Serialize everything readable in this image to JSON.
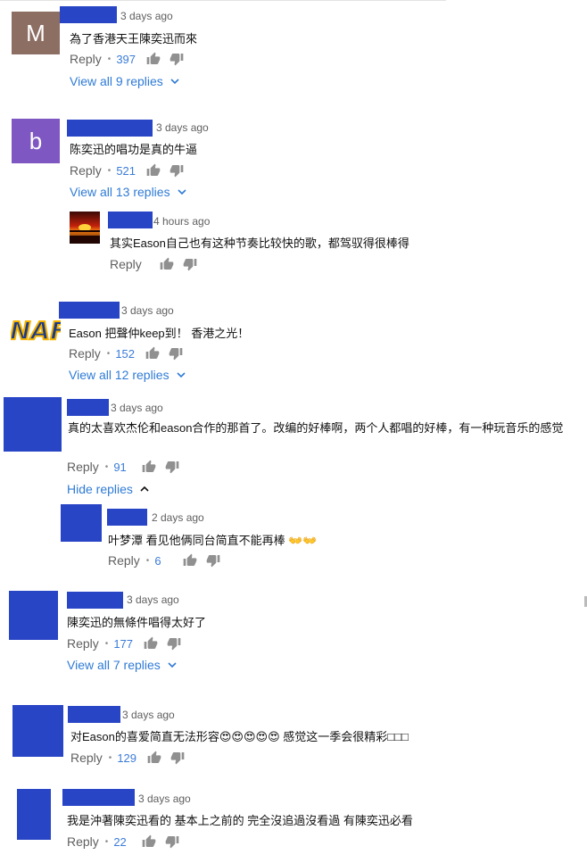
{
  "comments": [
    {
      "avatar_letter": "M",
      "avatar_color": "#8d6e63",
      "time": "3 days ago",
      "text": "為了香港天王陳奕迅而來",
      "reply_label": "Reply",
      "likes": "397",
      "view_replies": "View all 9 replies"
    },
    {
      "avatar_letter": "b",
      "avatar_color": "#7e57c2",
      "time": "3 days ago",
      "text": "陈奕迅的唱功是真的牛逼",
      "reply_label": "Reply",
      "likes": "521",
      "view_replies": "View all 13 replies",
      "reply": {
        "time": "4 hours ago",
        "text": "其实Eason自己也有这种节奏比较快的歌，都驾驭得很棒得",
        "reply_label": "Reply"
      }
    },
    {
      "avatar_text": "NAF",
      "time": "3 days ago",
      "text": "Eason 把聲仲keep到！ 香港之光！",
      "reply_label": "Reply",
      "likes": "152",
      "view_replies": "View all 12 replies"
    },
    {
      "time": "3 days ago",
      "text": "真的太喜欢杰伦和eason合作的那首了。改编的好棒啊，两个人都唱的好棒，有一种玩音乐的感觉",
      "reply_label": "Reply",
      "likes": "91",
      "hide_replies": "Hide replies",
      "reply": {
        "time": "2 days ago",
        "text": "叶梦潭 看见他俩同台简直不能再棒 👐👐",
        "reply_label": "Reply",
        "likes": "6"
      }
    },
    {
      "time": "3 days ago",
      "text": "陳奕迅的無條件唱得太好了",
      "reply_label": "Reply",
      "likes": "177",
      "view_replies": "View all 7 replies"
    },
    {
      "time": "3 days ago",
      "text": "对Eason的喜爱简直无法形容😍😍😍😍😍 感觉这一季会很精彩□□□",
      "reply_label": "Reply",
      "likes": "129"
    },
    {
      "time": "3 days ago",
      "text": "我是沖著陳奕迅看的 基本上之前的 完全沒追過沒看過 有陳奕迅必看",
      "reply_label": "Reply",
      "likes": "22"
    }
  ],
  "colors": {
    "redaction_blue": "#2845c6",
    "link_blue": "#2f7bd6",
    "count_blue": "#3b7cd8",
    "icon_gray": "#909090",
    "meta_gray": "#606060"
  },
  "icons": {
    "like": "thumbs-up-icon",
    "dislike": "thumbs-down-icon",
    "expand": "chevron-down-icon",
    "collapse": "chevron-up-icon"
  }
}
